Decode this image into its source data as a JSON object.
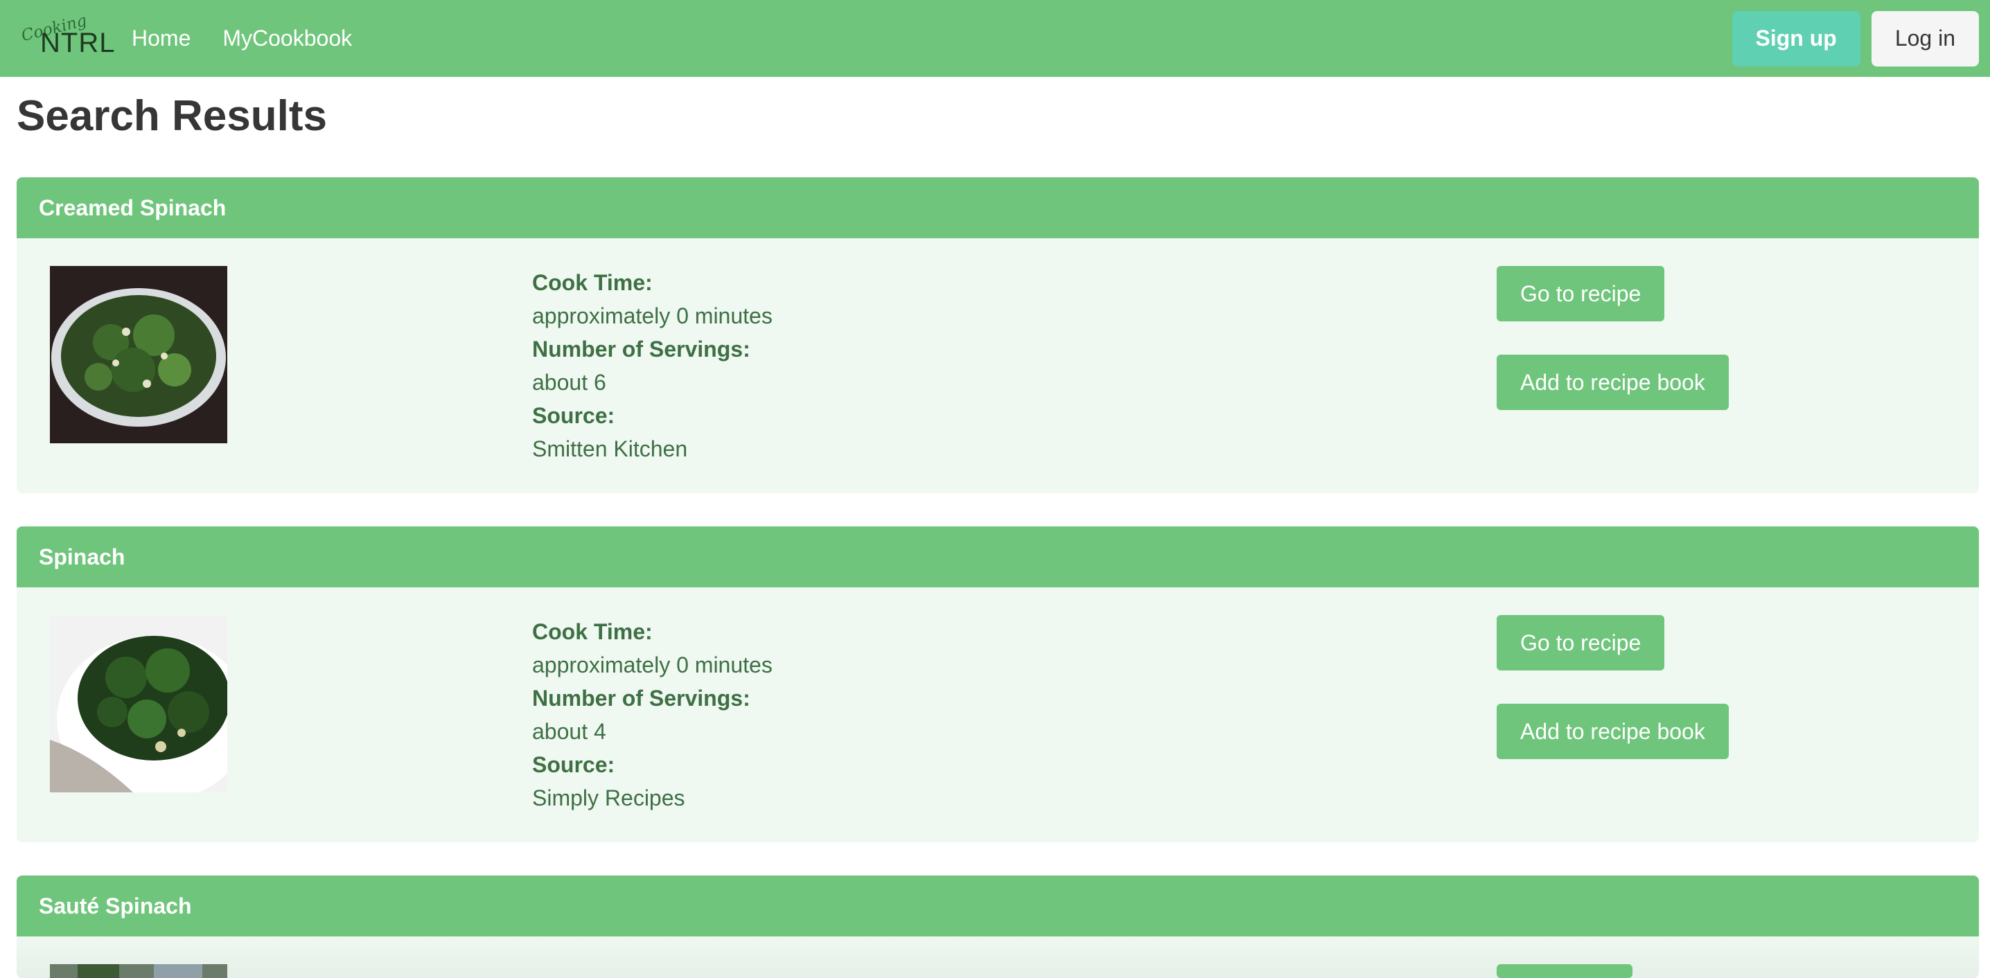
{
  "navbar": {
    "brand_script": "Cooking",
    "brand_word": "NTRL",
    "links": [
      "Home",
      "MyCookbook"
    ],
    "signup_label": "Sign up",
    "login_label": "Log in"
  },
  "page_title": "Search Results",
  "labels": {
    "cook_time": "Cook Time:",
    "servings": "Number of Servings:",
    "source": "Source:",
    "go_to_recipe": "Go to recipe",
    "add_to_book": "Add to recipe book"
  },
  "recipes": [
    {
      "title": "Creamed Spinach",
      "cook_time": "approximately 0 minutes",
      "servings": "about 6",
      "source": "Smitten Kitchen"
    },
    {
      "title": "Spinach",
      "cook_time": "approximately 0 minutes",
      "servings": "about 4",
      "source": "Simply Recipes"
    },
    {
      "title": "Sauté Spinach"
    }
  ],
  "colors": {
    "primary": "#6fc57b",
    "signup": "#5fd0b1",
    "card_bg": "#eff8f1",
    "text_green": "#3e7044"
  }
}
